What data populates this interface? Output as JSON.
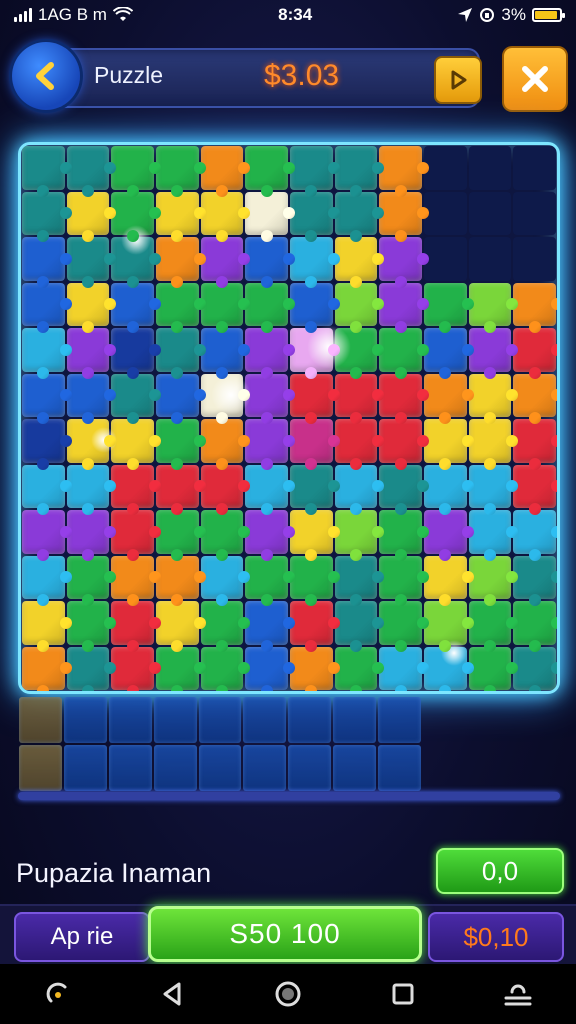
{
  "status_bar": {
    "carrier": "1AG B m",
    "time": "8:34",
    "battery_text": "3%",
    "battery_level": 0.9
  },
  "header": {
    "title": "Puzzle",
    "amount": "$3.03"
  },
  "board": {
    "rows": 12,
    "cols": 12,
    "palette": {
      "T": "#1a8a8a",
      "G": "#22b24a",
      "B": "#1e5fd0",
      "N": "#173a9e",
      "Y": "#f2d22a",
      "O": "#f28a1a",
      "R": "#e02a3a",
      "P": "#8a3ad8",
      "M": "#c8308a",
      "L": "#7ad63a",
      "C": "#2ab0e0",
      "W": "#f4f0d8",
      "K": "#e8a8f0",
      "E": "#0e1a4a"
    },
    "layout": [
      "TTGGOGTTOEEE",
      "TYGYYWTTOEEE",
      "BTTOPBCYPEEE",
      "BYBGGGBLPGLO",
      "CPNTBPKGGBPR",
      "BBTBWPRRROYO",
      "NYYGOPMRRYYR",
      "CCRRRCTCTCCR",
      "PPRGGPYLGPCC",
      "CGOOCGGTGYLT",
      "YGRYGBRTGLGG",
      "OTRGGBOGCCGT"
    ]
  },
  "tray": {
    "cols": 9,
    "rows": 2
  },
  "footer": {
    "info_label": "Pupazia Inaman",
    "info_value": "0,0",
    "left_button": "Ap rie",
    "center_button": "S50  100",
    "right_button": "$0,10"
  },
  "colors": {
    "accent_orange": "#ff8a2a",
    "board_glow": "#7ee6ff",
    "green_button": "#3fc72a"
  }
}
